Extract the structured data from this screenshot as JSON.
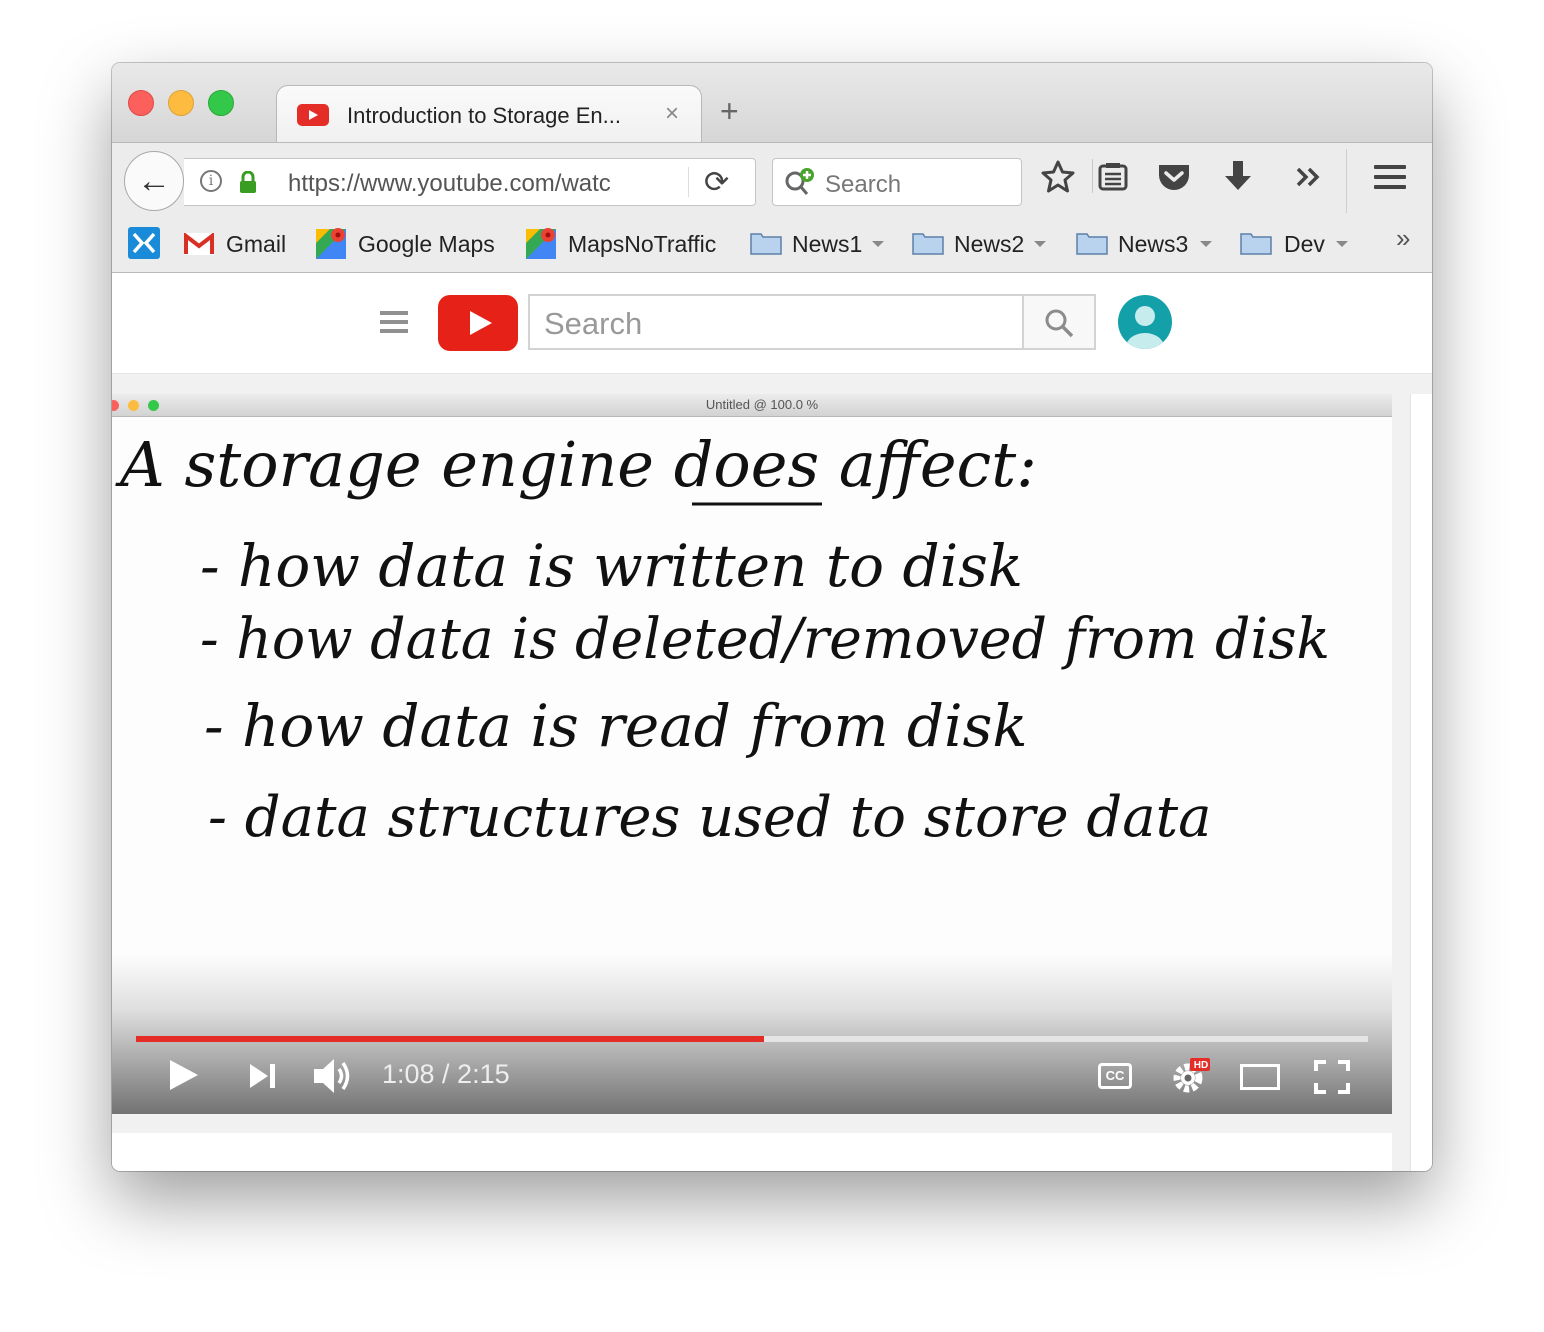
{
  "browser": {
    "tab": {
      "title": "Introduction to Storage En...",
      "close": "×"
    },
    "new_tab": "+",
    "url": "https://www.youtube.com/watc",
    "search_placeholder": "Search",
    "icons": [
      "back-arrow-icon",
      "info-icon",
      "lock-icon",
      "reload-icon",
      "search-plus-icon",
      "star-icon",
      "reader-list-icon",
      "pocket-icon",
      "download-icon",
      "overflow-chevrons-icon",
      "hamburger-menu-icon"
    ]
  },
  "bookmarks": {
    "items": [
      {
        "label": "",
        "icon": "app-icon"
      },
      {
        "label": "Gmail",
        "icon": "gmail-icon"
      },
      {
        "label": "Google Maps",
        "icon": "maps-icon"
      },
      {
        "label": "MapsNoTraffic",
        "icon": "maps-icon"
      },
      {
        "label": "News1",
        "icon": "folder-icon",
        "dropdown": true
      },
      {
        "label": "News2",
        "icon": "folder-icon",
        "dropdown": true
      },
      {
        "label": "News3",
        "icon": "folder-icon",
        "dropdown": true
      },
      {
        "label": "Dev",
        "icon": "folder-icon",
        "dropdown": true
      }
    ],
    "overflow": "»"
  },
  "youtube": {
    "search_placeholder": "Search"
  },
  "video": {
    "window_title": "Untitled @ 100.0 %",
    "handwritten_lines": [
      "A storage engine does affect:",
      "- how data is written to disk",
      "- how data is deleted/removed from disk",
      "- how data is read from disk",
      "- data structures used to store data"
    ],
    "time": "1:08 / 2:15",
    "progress": 0.51,
    "controls": [
      "play-icon",
      "next-icon",
      "volume-icon",
      "cc-icon",
      "settings-hd-icon",
      "theater-icon",
      "fullscreen-icon"
    ],
    "hd_badge": "HD",
    "cc_label": "CC"
  },
  "colors": {
    "youtube_red": "#e62117",
    "progress_red": "#e52d27",
    "avatar_teal": "#14a0a8",
    "lock_green": "#3a9d23"
  }
}
